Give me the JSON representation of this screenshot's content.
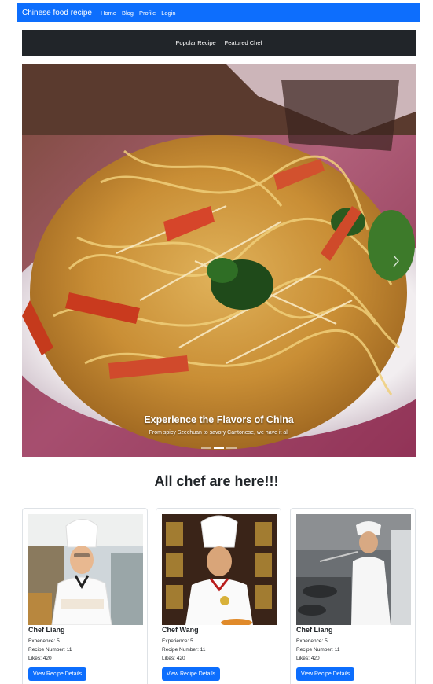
{
  "navbar": {
    "brand": "Chinese food recipe",
    "links": [
      "Home",
      "Blog",
      "Profile",
      "Login"
    ]
  },
  "subnav": {
    "links": [
      "Popular Recipe",
      "Featured Chef"
    ]
  },
  "carousel": {
    "title": "Experience the Flavors of China",
    "subtitle": "From spicy Szechuan to savory Cantonese, we have it all",
    "slide_count": 3,
    "active_slide": 2
  },
  "section_heading": "All chef are here!!!",
  "chefs": [
    {
      "name": "Chef Liang",
      "experience": "Experience: 5",
      "recipes": "Recipe Number: 11",
      "likes": "Likes: 420",
      "button": "View Recipe Details"
    },
    {
      "name": "Chef Wang",
      "experience": "Experience: 5",
      "recipes": "Recipe Number: 11",
      "likes": "Likes: 420",
      "button": "View Recipe Details"
    },
    {
      "name": "Chef Liang",
      "experience": "Experience: 5",
      "recipes": "Recipe Number: 11",
      "likes": "Likes: 420",
      "button": "View Recipe Details"
    }
  ],
  "colors": {
    "primary": "#0d6efd",
    "dark": "#212529"
  },
  "icons": {
    "carousel_next": "chevron-right-icon"
  }
}
